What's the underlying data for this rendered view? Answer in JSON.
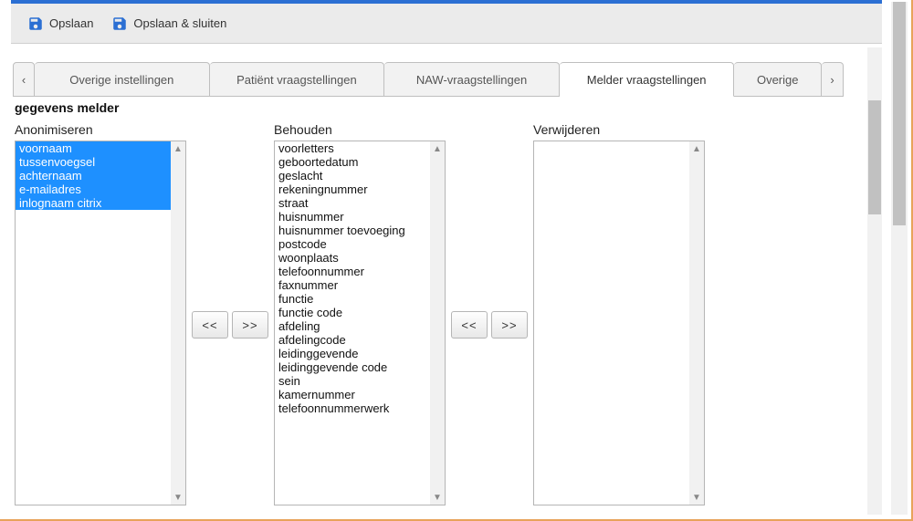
{
  "toolbar": {
    "save_label": "Opslaan",
    "save_close_label": "Opslaan & sluiten"
  },
  "tabs": {
    "items": [
      {
        "label": "Overige instellingen",
        "active": false
      },
      {
        "label": "Patiënt vraagstellingen",
        "active": false
      },
      {
        "label": "NAW-vraagstellingen",
        "active": false
      },
      {
        "label": "Melder vraagstellingen",
        "active": true
      },
      {
        "label": "Overige",
        "active": false
      }
    ]
  },
  "section": {
    "title": "gegevens melder"
  },
  "columns": {
    "anonimiseren": {
      "label": "Anonimiseren",
      "items": [
        {
          "text": "voornaam",
          "selected": true
        },
        {
          "text": "tussenvoegsel",
          "selected": true
        },
        {
          "text": "achternaam",
          "selected": true
        },
        {
          "text": "e-mailadres",
          "selected": true
        },
        {
          "text": "inlognaam citrix",
          "selected": true
        }
      ]
    },
    "behouden": {
      "label": "Behouden",
      "items": [
        {
          "text": "voorletters"
        },
        {
          "text": "geboortedatum"
        },
        {
          "text": "geslacht"
        },
        {
          "text": "rekeningnummer"
        },
        {
          "text": "straat"
        },
        {
          "text": "huisnummer"
        },
        {
          "text": "huisnummer toevoeging"
        },
        {
          "text": "postcode"
        },
        {
          "text": "woonplaats"
        },
        {
          "text": "telefoonnummer"
        },
        {
          "text": "faxnummer"
        },
        {
          "text": "functie"
        },
        {
          "text": "functie code"
        },
        {
          "text": "afdeling"
        },
        {
          "text": "afdelingcode"
        },
        {
          "text": "leidinggevende"
        },
        {
          "text": "leidinggevende code"
        },
        {
          "text": "sein"
        },
        {
          "text": "kamernummer"
        },
        {
          "text": "telefoonnummerwerk"
        }
      ]
    },
    "verwijderen": {
      "label": "Verwijderen",
      "items": []
    }
  },
  "buttons": {
    "move_left": "<<",
    "move_right": ">>"
  },
  "glyphs": {
    "chevron_left": "‹",
    "chevron_right": "›",
    "arrow_up": "▲",
    "arrow_down": "▼"
  }
}
